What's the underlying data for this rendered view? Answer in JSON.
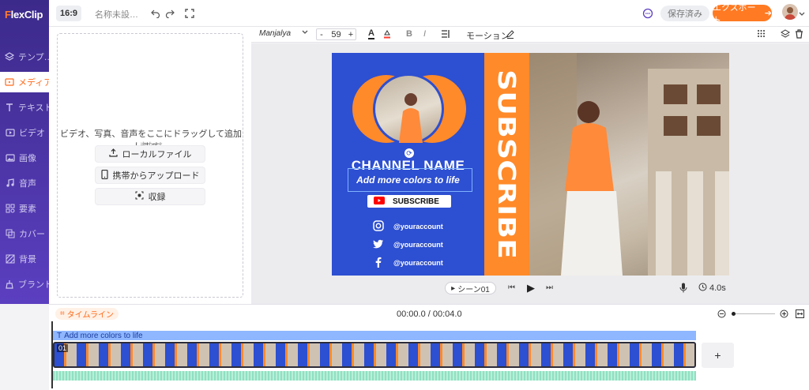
{
  "app": {
    "logo_f": "F",
    "logo_rest": "lexClip"
  },
  "sidebar": {
    "items": [
      {
        "label": "テンプ…",
        "icon": "template-icon"
      },
      {
        "label": "メディア",
        "icon": "media-icon",
        "active": true
      },
      {
        "label": "テキスト",
        "icon": "text-icon"
      },
      {
        "label": "ビデオ",
        "icon": "video-icon"
      },
      {
        "label": "画像",
        "icon": "image-icon"
      },
      {
        "label": "音声",
        "icon": "music-icon"
      },
      {
        "label": "要素",
        "icon": "elements-icon"
      },
      {
        "label": "カバー",
        "icon": "cover-icon"
      },
      {
        "label": "背景",
        "icon": "background-icon"
      },
      {
        "label": "ブランド",
        "icon": "brand-icon"
      }
    ]
  },
  "topbar": {
    "ratio": "16:9",
    "project_name": "名称未設…",
    "saved": "保存済み",
    "export": "エクスポート",
    "accent": "#ff7a22"
  },
  "media": {
    "drop_text": "ビデオ、写真、音声をここにドラッグして追加します。",
    "or_text": "または",
    "local_file": "ローカルファイル",
    "mobile_upload": "携帯からアップロード",
    "record": "収録"
  },
  "text_toolbar": {
    "font": "Manjalya",
    "font_size": "59",
    "minus": "-",
    "plus": "+",
    "text_color_glyph": "A",
    "bold": "B",
    "italic": "I",
    "motion": "モーション"
  },
  "canvas": {
    "channel_name": "CHANNEL NAME",
    "tagline": "Add more colors to life",
    "subscribe_button": "SUBSCRIBE",
    "vertical_text": "SUBSCRIBE",
    "social": [
      "@youraccount",
      "@youraccount",
      "@youraccount"
    ],
    "blue": "#2d4fd1",
    "orange": "#ff8a2a"
  },
  "playback": {
    "scene_label": "シーン01",
    "duration": "4.0s"
  },
  "timeline": {
    "label": "タイムライン",
    "time": "00:00.0 / 00:04.0",
    "text_clip": "Add more colors to life",
    "clip_number": "01",
    "add": "+"
  }
}
